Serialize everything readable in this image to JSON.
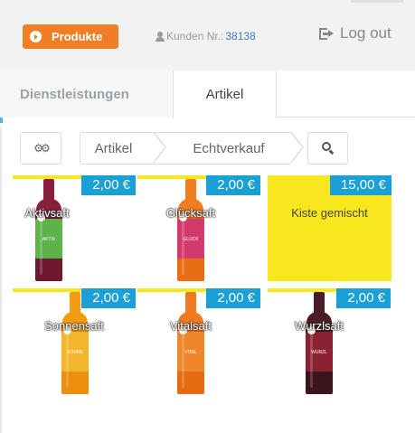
{
  "header": {
    "produkte_label": "Produkte",
    "kunden_label": "Kunden Nr.:",
    "kunden_nr": "38138",
    "logout_label": "Log out"
  },
  "tabs": [
    {
      "label": "Dienstleistungen",
      "active": false
    },
    {
      "label": "Artikel",
      "active": true
    }
  ],
  "breadcrumb": {
    "settings_icon": "cogs-icon",
    "items": [
      "Artikel",
      "Echtverkauf"
    ],
    "search_icon": "search-icon"
  },
  "products": [
    {
      "name": "Aktivsaft",
      "price": "2,00 €",
      "bottle_label": "AKTIV",
      "colors": {
        "top": "#8a1f3a",
        "label": "#5db34a"
      }
    },
    {
      "name": "Glücksaft",
      "price": "2,00 €",
      "bottle_label": "GLÜCK",
      "colors": {
        "top": "#f07d1e",
        "label": "#d23a6e"
      }
    },
    {
      "name": "Kiste gemischt",
      "price": "15,00 €",
      "bottle_label": "",
      "colors": {
        "bg": "#f8e71c"
      }
    },
    {
      "name": "Sonnensaft",
      "price": "2,00 €",
      "bottle_label": "SONNE",
      "colors": {
        "top": "#f39c12",
        "label": "#f2b52c"
      }
    },
    {
      "name": "Vitalsaft",
      "price": "2,00 €",
      "bottle_label": "VITAL",
      "colors": {
        "top": "#ef7b1e",
        "label": "#f0862a"
      }
    },
    {
      "name": "Wurzlsaft",
      "price": "2,00 €",
      "bottle_label": "WURZL",
      "colors": {
        "top": "#4a1c26",
        "label": "#8b2234"
      }
    }
  ],
  "colors": {
    "accent_orange": "#f07e26",
    "price_blue": "#1a9fd6",
    "highlight_yellow": "#f8e71c",
    "link_blue": "#3a7dbf"
  }
}
